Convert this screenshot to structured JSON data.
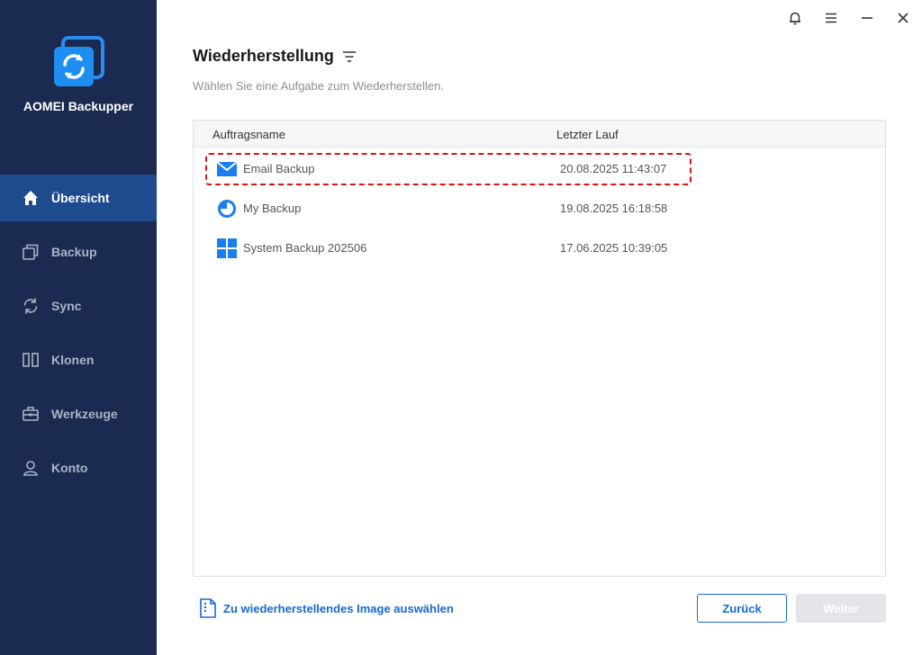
{
  "app": {
    "name": "AOMEI Backupper"
  },
  "sidebar": {
    "items": [
      {
        "label": "Übersicht",
        "icon": "home-icon",
        "active": true
      },
      {
        "label": "Backup",
        "icon": "backup-icon"
      },
      {
        "label": "Sync",
        "icon": "sync-icon"
      },
      {
        "label": "Klonen",
        "icon": "clone-icon"
      },
      {
        "label": "Werkzeuge",
        "icon": "toolbox-icon"
      },
      {
        "label": "Konto",
        "icon": "user-icon"
      }
    ]
  },
  "titlebar": {
    "icons": [
      "bell-icon",
      "menu-icon",
      "minimize-icon",
      "close-icon"
    ]
  },
  "main": {
    "title": "Wiederherstellung",
    "subtitle": "Wählen Sie eine Aufgabe zum Wiederherstellen.",
    "table": {
      "columns": [
        "Auftragsname",
        "Letzter Lauf"
      ],
      "rows": [
        {
          "name": "Email Backup",
          "date": "20.08.2025 11:43:07",
          "icon": "email-icon",
          "selected": true
        },
        {
          "name": "My Backup",
          "date": "19.08.2025 16:18:58",
          "icon": "pie-icon"
        },
        {
          "name": "System Backup 202506",
          "date": "17.06.2025 10:39:05",
          "icon": "windows-icon"
        }
      ]
    }
  },
  "footer": {
    "select_image": "Zu wiederherstellendes Image auswählen",
    "back": "Zurück",
    "next": "Weiter"
  },
  "colors": {
    "sidebar": "#1b2a50",
    "active": "#1e4a8e",
    "accent": "#1769d2",
    "highlight": "#e0101a"
  }
}
